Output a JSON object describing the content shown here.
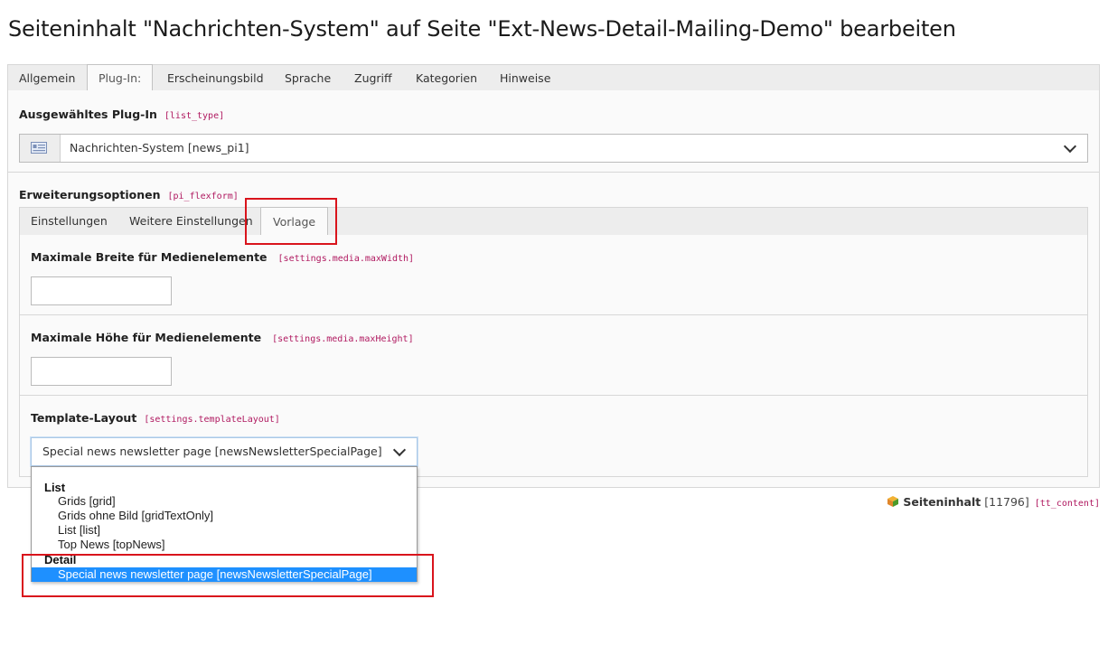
{
  "page": {
    "title": "Seiteninhalt \"Nachrichten-System\" auf Seite \"Ext-News-Detail-Mailing-Demo\" bearbeiten"
  },
  "tabs": [
    {
      "label": "Allgemein"
    },
    {
      "label": "Plug-In:"
    },
    {
      "label": "Erscheinungsbild"
    },
    {
      "label": "Sprache"
    },
    {
      "label": "Zugriff"
    },
    {
      "label": "Kategorien"
    },
    {
      "label": "Hinweise"
    }
  ],
  "plugin": {
    "label": "Ausgewähltes Plug-In",
    "field": "[list_type]",
    "selected": "Nachrichten-System [news_pi1]",
    "icon": "plugin-icon"
  },
  "flexform": {
    "label": "Erweiterungsoptionen",
    "field": "[pi_flexform]",
    "tabs": [
      {
        "label": "Einstellungen"
      },
      {
        "label": "Weitere Einstellungen"
      },
      {
        "label": "Vorlage"
      }
    ]
  },
  "fields": {
    "max_width": {
      "label": "Maximale Breite für Medienelemente",
      "field": "[settings.media.maxWidth]",
      "value": ""
    },
    "max_height": {
      "label": "Maximale Höhe für Medienelemente",
      "field": "[settings.media.maxHeight]",
      "value": ""
    },
    "template_layout": {
      "label": "Template-Layout",
      "field": "[settings.templateLayout]",
      "selected": "Special news newsletter page [newsNewsletterSpecialPage]"
    }
  },
  "dropdown": {
    "groups": [
      {
        "label": "List",
        "options": [
          "Grids [grid]",
          "Grids ohne Bild [gridTextOnly]",
          "List [list]",
          "Top News [topNews]"
        ]
      },
      {
        "label": "Detail",
        "options": [
          "Special news newsletter page [newsNewsletterSpecialPage]"
        ]
      }
    ]
  },
  "record": {
    "type": "Seiteninhalt",
    "uid": "[11796]",
    "table": "[tt_content]"
  },
  "colors": {
    "highlight": "#d9141c",
    "selected_option": "#1e90ff",
    "field_code": "#b01960"
  }
}
